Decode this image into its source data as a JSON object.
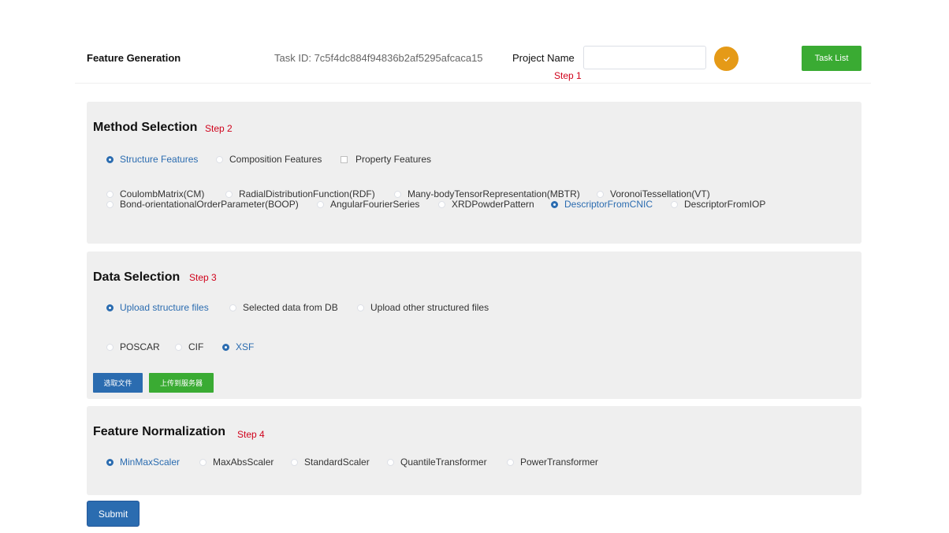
{
  "header": {
    "title": "Feature Generation",
    "task_id": "Task ID: 7c5f4dc884f94836b2af5295afcaca15",
    "project_label": "Project Name",
    "project_value": "",
    "step": "Step 1",
    "confirm_icon": "check-icon",
    "task_list_label": "Task List"
  },
  "method": {
    "title": "Method Selection",
    "step": "Step 2",
    "types": [
      "Structure Features",
      "Composition Features",
      "Property Features"
    ],
    "selected_type": "Structure Features",
    "methods_row1": [
      "CoulombMatrix(CM)",
      "RadialDistributionFunction(RDF)",
      "Many-bodyTensorRepresentation(MBTR)",
      "VoronoiTessellation(VT)"
    ],
    "methods_row2": [
      "Bond-orientationalOrderParameter(BOOP)",
      "AngularFourierSeries",
      "XRDPowderPattern",
      "DescriptorFromCNIC",
      "DescriptorFromIOP"
    ],
    "selected_method": "DescriptorFromCNIC"
  },
  "data": {
    "title": "Data Selection",
    "step": "Step 3",
    "sources": [
      "Upload structure files",
      "Selected data from DB",
      "Upload other structured files"
    ],
    "selected_source": "Upload structure files",
    "formats": [
      "POSCAR",
      "CIF",
      "XSF"
    ],
    "selected_format": "XSF",
    "choose_file_label": "选取文件",
    "upload_label": "上传到服务器"
  },
  "normalization": {
    "title": "Feature Normalization",
    "step": "Step 4",
    "options": [
      "MinMaxScaler",
      "MaxAbsScaler",
      "StandardScaler",
      "QuantileTransformer",
      "PowerTransformer"
    ],
    "selected": "MinMaxScaler"
  },
  "submit_label": "Submit",
  "colors": {
    "accent_blue": "#2b6cb0",
    "green": "#3aab33",
    "orange": "#e59a17",
    "step_red": "#d0021b",
    "panel_bg": "#efefef"
  }
}
